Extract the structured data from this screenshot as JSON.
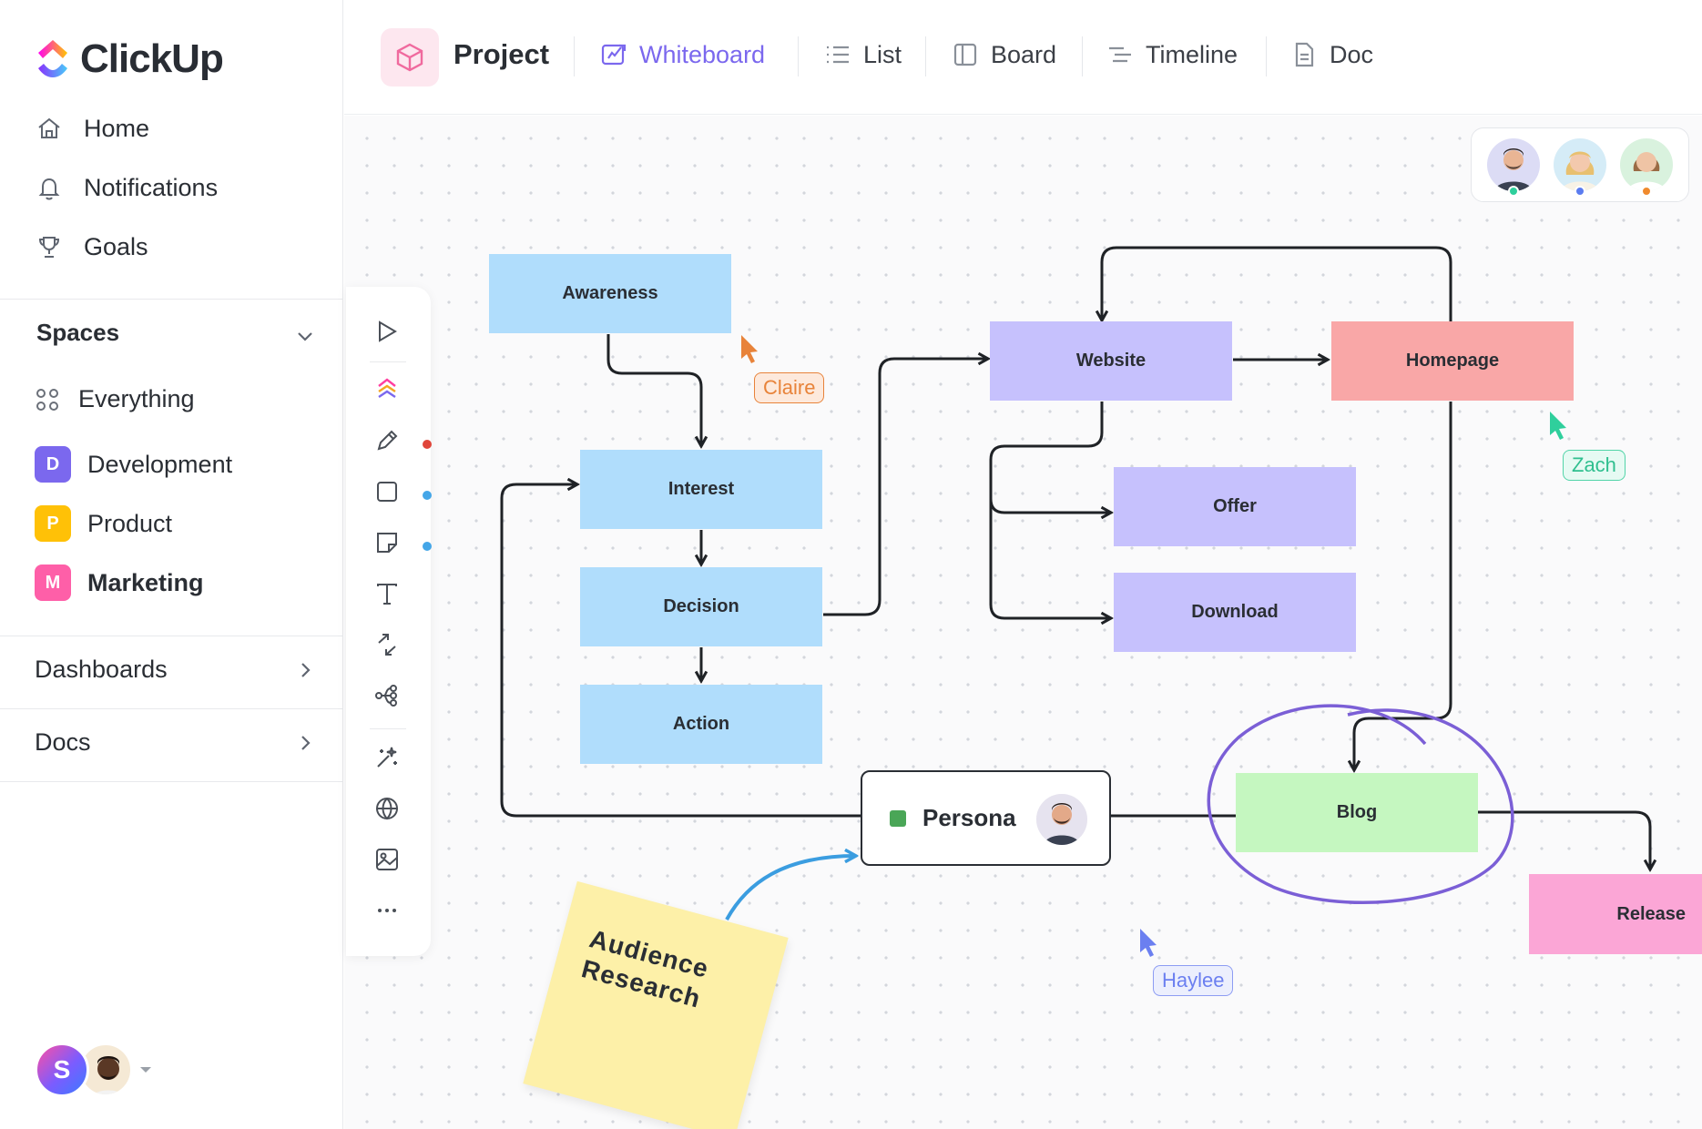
{
  "app": {
    "name": "ClickUp"
  },
  "sidebar": {
    "nav": [
      {
        "label": "Home",
        "icon": "home-icon"
      },
      {
        "label": "Notifications",
        "icon": "bell-icon"
      },
      {
        "label": "Goals",
        "icon": "trophy-icon"
      }
    ],
    "spaces_title": "Spaces",
    "everything_label": "Everything",
    "spaces": [
      {
        "letter": "D",
        "label": "Development",
        "color": "#7b68ee"
      },
      {
        "letter": "P",
        "label": "Product",
        "color": "#ffc107"
      },
      {
        "letter": "M",
        "label": "Marketing",
        "color": "#fe5fa8"
      }
    ],
    "dashboards_label": "Dashboards",
    "docs_label": "Docs",
    "user_initial": "S"
  },
  "topbar": {
    "project_title": "Project",
    "tabs": [
      {
        "label": "Whiteboard",
        "active": true,
        "icon": "whiteboard-icon"
      },
      {
        "label": "List",
        "active": false,
        "icon": "list-icon"
      },
      {
        "label": "Board",
        "active": false,
        "icon": "board-icon"
      },
      {
        "label": "Timeline",
        "active": false,
        "icon": "timeline-icon"
      },
      {
        "label": "Doc",
        "active": false,
        "icon": "doc-icon"
      }
    ]
  },
  "whiteboard": {
    "nodes": {
      "awareness": "Awareness",
      "interest": "Interest",
      "decision": "Decision",
      "action": "Action",
      "website": "Website",
      "homepage": "Homepage",
      "offer": "Offer",
      "download": "Download",
      "blog": "Blog",
      "release": "Release",
      "persona": "Persona"
    },
    "sticky_note": "Audience Research",
    "cursors": [
      {
        "name": "Claire",
        "color": "#e8833a"
      },
      {
        "name": "Zach",
        "color": "#2fcf9c"
      },
      {
        "name": "Haylee",
        "color": "#6b7ff0"
      }
    ],
    "collaborator_status_colors": [
      "#2fcf9c",
      "#5b7cf0",
      "#f08a2d"
    ]
  },
  "colors": {
    "accent": "#7b68ee",
    "node_blue": "#b0ddfc",
    "node_purple": "#c6c1fd",
    "node_red": "#f9a7a7",
    "node_green": "#c5f7c0",
    "node_pink": "#fba6d6"
  }
}
